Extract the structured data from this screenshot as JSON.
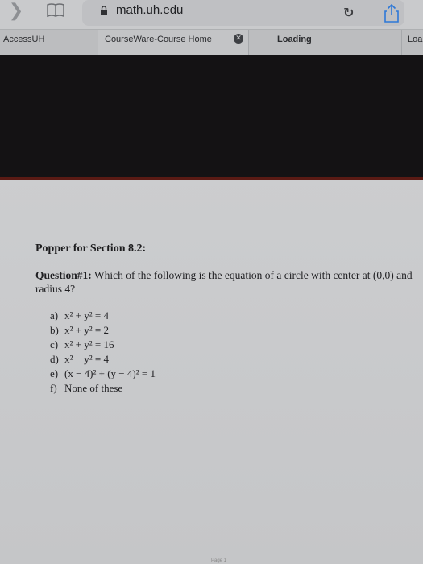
{
  "browser": {
    "url": "math.uh.edu",
    "tabs": [
      {
        "label": "AccessUH"
      },
      {
        "label": "CourseWare-Course Home"
      },
      {
        "label": "Loading"
      },
      {
        "label": "Loa"
      }
    ]
  },
  "document": {
    "heading": "Popper for Section 8.2:",
    "question_label": "Question#1:",
    "question_text": "Which of the following is the equation of a circle with center at (0,0) and radius 4?",
    "options": [
      {
        "letter": "a)",
        "text": "x² + y² = 4"
      },
      {
        "letter": "b)",
        "text": "x² + y² = 2"
      },
      {
        "letter": "c)",
        "text": "x² + y² = 16"
      },
      {
        "letter": "d)",
        "text": "x² − y² = 4"
      },
      {
        "letter": "e)",
        "text": "(x − 4)² + (y − 4)² = 1"
      },
      {
        "letter": "f)",
        "text": "None of these"
      }
    ],
    "page_footer": "Page 1"
  }
}
